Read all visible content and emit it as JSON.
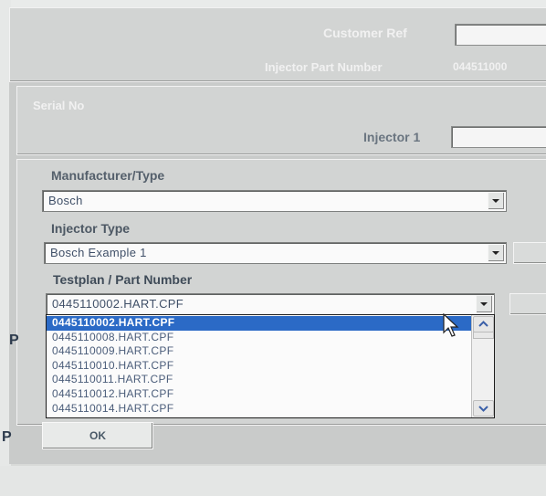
{
  "header": {
    "customer_ref_label": "Customer Ref",
    "injector_part_number_label": "Injector Part Number",
    "injector_part_number_value": "044511000",
    "serial_no_label": "Serial No",
    "injector1_label": "Injector 1"
  },
  "form": {
    "manufacturer_label": "Manufacturer/Type",
    "manufacturer_value": "Bosch",
    "injector_type_label": "Injector Type",
    "injector_type_value": "Bosch Example 1",
    "testplan_label": "Testplan / Part Number",
    "testplan_value": "0445110002.HART.CPF"
  },
  "dropdown": {
    "items": [
      "0445110002.HART.CPF",
      "0445110008.HART.CPF",
      "0445110009.HART.CPF",
      "0445110010.HART.CPF",
      "0445110011.HART.CPF",
      "0445110012.HART.CPF",
      "0445110014.HART.CPF"
    ],
    "selected_index": 0
  },
  "footer": {
    "ok_label": "OK"
  },
  "background": {
    "p_letter": "P"
  }
}
